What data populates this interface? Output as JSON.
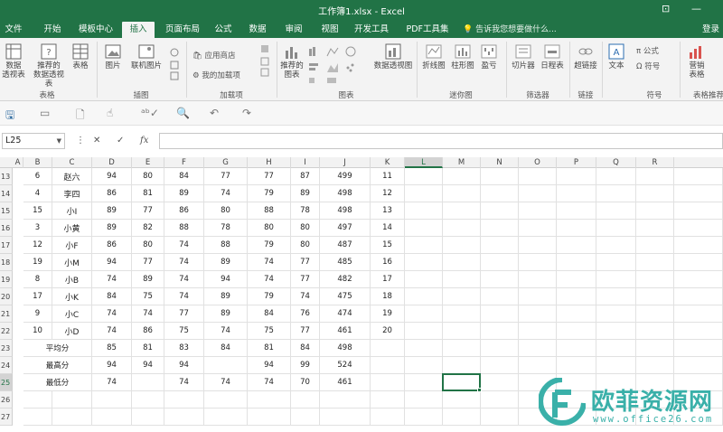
{
  "window": {
    "title": "工作簿1.xlsx - Excel",
    "login_label": "登录",
    "tell_me": "告诉我您想要做什么..."
  },
  "tabs": [
    "文件",
    "开始",
    "模板中心",
    "插入",
    "页面布局",
    "公式",
    "数据",
    "审阅",
    "视图",
    "开发工具",
    "PDF工具集"
  ],
  "active_tab": "插入",
  "ribbon": {
    "groups": {
      "tables": "表格",
      "illustrations": "插图",
      "addins": "加载项",
      "charts": "图表",
      "sparklines": "迷你图",
      "filters": "筛选器",
      "links": "链接",
      "symbols": "符号",
      "table_recommend": "表格推荐"
    },
    "buttons": {
      "pivot_table": "数据\n透视表",
      "recommended_pivot": "推荐的\n数据透视表",
      "table": "表格",
      "picture": "图片",
      "online_picture": "联机图片",
      "app_store": "应用商店",
      "my_addins": "我的加载项",
      "recommended_charts": "推荐的\n图表",
      "pivot_chart": "数据透视图",
      "line_spark": "折线图",
      "column_spark": "柱形图",
      "winloss_spark": "盈亏",
      "slicer": "切片器",
      "timeline": "日程表",
      "hyperlink": "超链接",
      "text": "文本",
      "equation": "π 公式",
      "symbol": "Ω 符号",
      "sales_table": "营销\n表格"
    }
  },
  "formula_bar": {
    "name_box": "L25",
    "cancel_icon": "✕",
    "enter_icon": "✓",
    "fx_label": "fx",
    "formula": ""
  },
  "columns": [
    "A",
    "B",
    "C",
    "D",
    "E",
    "F",
    "G",
    "H",
    "I",
    "J",
    "K",
    "L",
    "M",
    "N",
    "O",
    "P",
    "Q",
    "R"
  ],
  "selected_column": "L",
  "selected_row": "25",
  "rows": [
    {
      "n": "13",
      "cells": [
        "6",
        "赵六",
        "94",
        "80",
        "84",
        "77",
        "77",
        "87",
        "499",
        "11"
      ]
    },
    {
      "n": "14",
      "cells": [
        "4",
        "李四",
        "86",
        "81",
        "89",
        "74",
        "79",
        "89",
        "498",
        "12"
      ]
    },
    {
      "n": "15",
      "cells": [
        "15",
        "小I",
        "89",
        "77",
        "86",
        "80",
        "88",
        "78",
        "498",
        "13"
      ]
    },
    {
      "n": "16",
      "cells": [
        "3",
        "小黄",
        "89",
        "82",
        "88",
        "78",
        "80",
        "80",
        "497",
        "14"
      ]
    },
    {
      "n": "17",
      "cells": [
        "12",
        "小F",
        "86",
        "80",
        "74",
        "88",
        "79",
        "80",
        "487",
        "15"
      ]
    },
    {
      "n": "18",
      "cells": [
        "19",
        "小M",
        "94",
        "77",
        "74",
        "89",
        "74",
        "77",
        "485",
        "16"
      ]
    },
    {
      "n": "19",
      "cells": [
        "8",
        "小B",
        "74",
        "89",
        "74",
        "94",
        "74",
        "77",
        "482",
        "17"
      ]
    },
    {
      "n": "20",
      "cells": [
        "17",
        "小K",
        "84",
        "75",
        "74",
        "89",
        "79",
        "74",
        "475",
        "18"
      ]
    },
    {
      "n": "21",
      "cells": [
        "9",
        "小C",
        "74",
        "74",
        "77",
        "89",
        "84",
        "76",
        "474",
        "19"
      ]
    },
    {
      "n": "22",
      "cells": [
        "10",
        "小D",
        "74",
        "86",
        "75",
        "74",
        "75",
        "77",
        "461",
        "20"
      ]
    },
    {
      "n": "23",
      "cells": [
        "平均分",
        "",
        "85",
        "81",
        "83",
        "84",
        "81",
        "84",
        "498",
        ""
      ]
    },
    {
      "n": "24",
      "cells": [
        "最高分",
        "",
        "94",
        "94",
        "94",
        "",
        "94",
        "99",
        "524",
        ""
      ]
    },
    {
      "n": "25",
      "cells": [
        "最低分",
        "",
        "74",
        "",
        "74",
        "74",
        "74",
        "70",
        "461",
        ""
      ]
    },
    {
      "n": "26",
      "cells": [
        "",
        "",
        "",
        "",
        "",
        "",
        "",
        "",
        "",
        ""
      ]
    },
    {
      "n": "27",
      "cells": [
        "",
        "",
        "",
        "",
        "",
        "",
        "",
        "",
        "",
        ""
      ]
    }
  ],
  "watermark": {
    "name": "欧菲资源网",
    "url": "www.office26.com"
  }
}
